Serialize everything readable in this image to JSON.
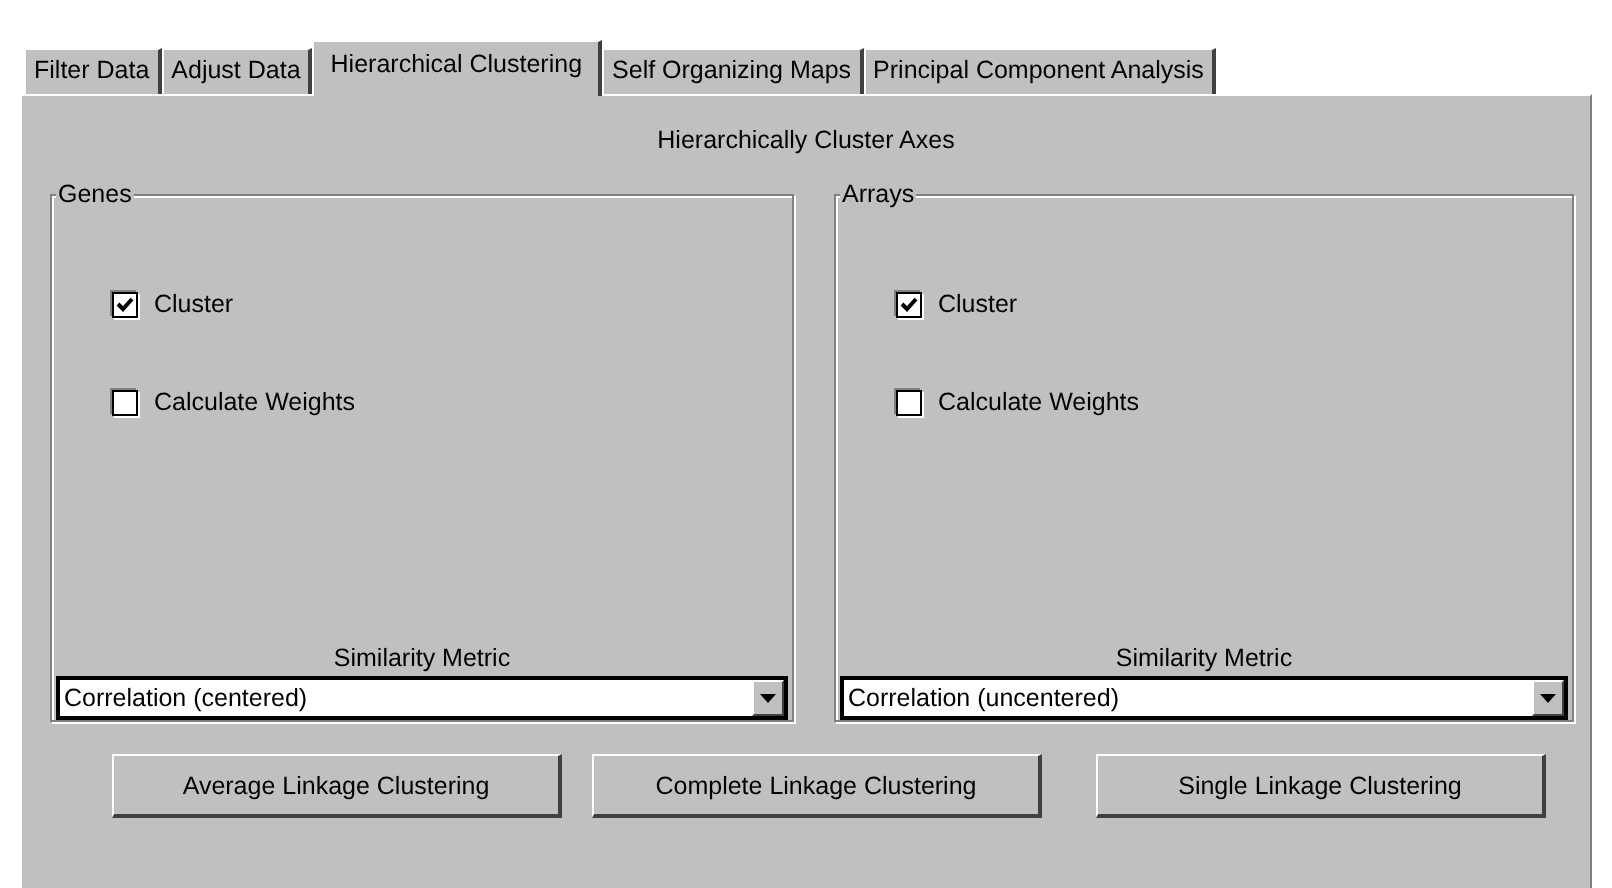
{
  "tabs": [
    {
      "label": "Filter Data",
      "selected": false
    },
    {
      "label": "Adjust Data",
      "selected": false
    },
    {
      "label": "Hierarchical Clustering",
      "selected": true
    },
    {
      "label": "Self Organizing Maps",
      "selected": false
    },
    {
      "label": "Principal Component Analysis",
      "selected": false
    }
  ],
  "heading": "Hierarchically Cluster Axes",
  "groups": [
    {
      "title": "Genes",
      "options": [
        {
          "label": "Cluster",
          "checked": true
        },
        {
          "label": "Calculate Weights",
          "checked": false
        }
      ],
      "metric_label": "Similarity Metric",
      "metric": "Correlation (centered)"
    },
    {
      "title": "Arrays",
      "options": [
        {
          "label": "Cluster",
          "checked": true
        },
        {
          "label": "Calculate Weights",
          "checked": false
        }
      ],
      "metric_label": "Similarity Metric",
      "metric": "Correlation (uncentered)"
    }
  ],
  "buttons": [
    "Average Linkage Clustering",
    "Complete Linkage Clustering",
    "Single Linkage Clustering"
  ]
}
